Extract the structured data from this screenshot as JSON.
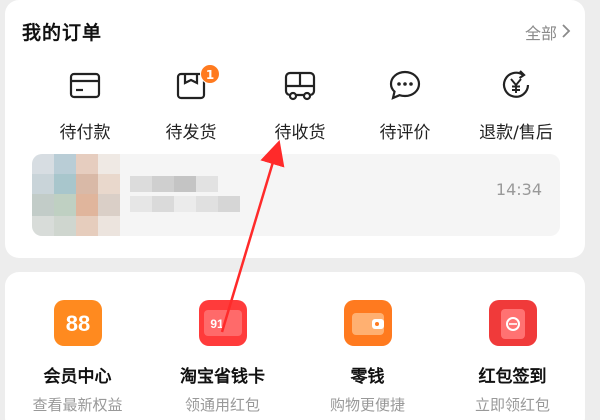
{
  "orders": {
    "title": "我的订单",
    "all_label": "全部",
    "items": [
      {
        "label": "待付款",
        "icon": "wallet-card-icon"
      },
      {
        "label": "待发货",
        "icon": "package-box-icon",
        "badge": "1"
      },
      {
        "label": "待收货",
        "icon": "delivery-truck-icon"
      },
      {
        "label": "待评价",
        "icon": "chat-bubble-icon"
      },
      {
        "label": "退款/售后",
        "icon": "refund-yen-icon"
      }
    ],
    "recent": {
      "time": "14:34"
    }
  },
  "services": [
    {
      "name": "会员中心",
      "sub": "查看最新权益",
      "icon_text": "88",
      "color": "#ff8a1f"
    },
    {
      "name": "淘宝省钱卡",
      "sub": "领通用红包",
      "icon_text": "91",
      "color": "#ff3b3b"
    },
    {
      "name": "零钱",
      "sub": "购物更便捷",
      "icon_text": "",
      "color": "#ff7a1f"
    },
    {
      "name": "红包签到",
      "sub": "立即领红包",
      "icon_text": "",
      "color": "#f03a3a"
    }
  ],
  "colors": {
    "accent_orange": "#ff7a1f",
    "annotation_arrow": "#ff2a2a",
    "muted_text": "#999999"
  }
}
